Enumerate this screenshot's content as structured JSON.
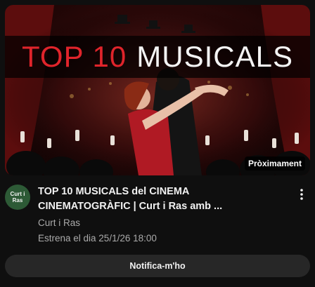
{
  "thumbnail": {
    "title_part1": "TOP 10",
    "title_part2": "MUSICALS",
    "badge": "Pròximament"
  },
  "channel": {
    "avatar_text": "Curt i Ras",
    "name": "Curt i Ras"
  },
  "video": {
    "title": "TOP 10 MUSICALS del CINEMA CINEMATOGRÀFIC | Curt i Ras amb ...",
    "premiere": "Estrena el dia 25/1/26 18:00"
  },
  "actions": {
    "notify_label": "Notifica-m'ho",
    "more_icon": "more-vert-icon"
  },
  "colors": {
    "title_red": "#e0242b",
    "avatar_green": "#2d5a36",
    "button_bg": "#272727",
    "secondary_text": "#aaaaaa"
  }
}
